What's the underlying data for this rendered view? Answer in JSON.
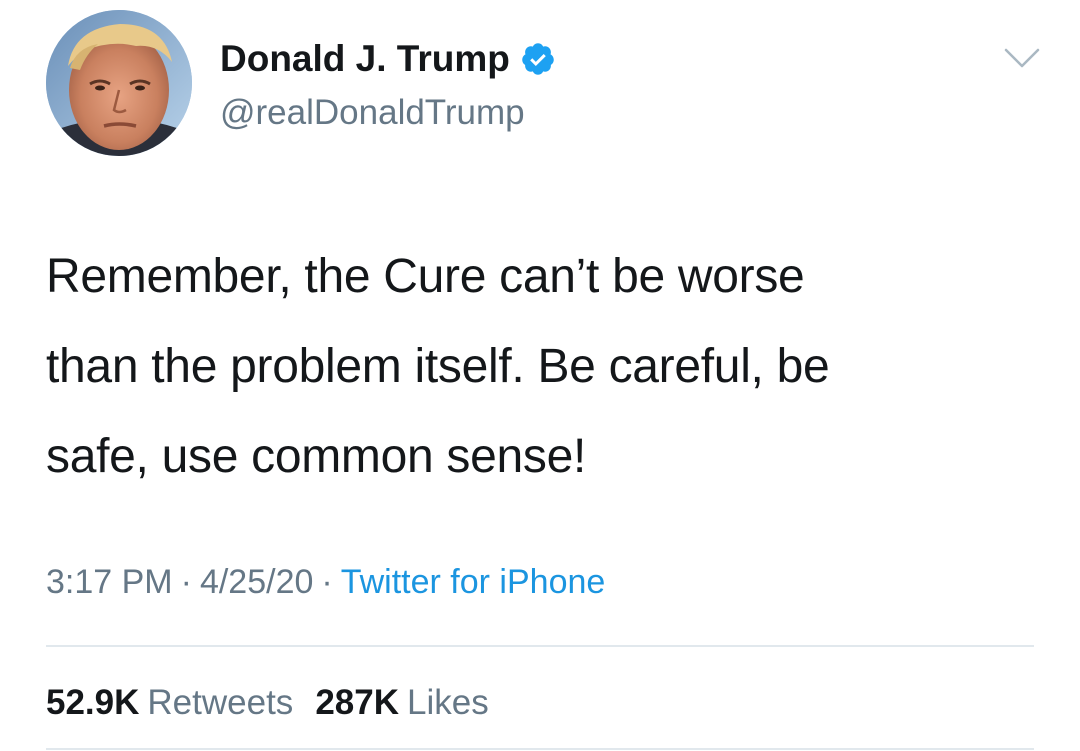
{
  "author": {
    "display_name": "Donald J. Trump",
    "handle": "@realDonaldTrump",
    "verified": true,
    "avatar_icon": "profile-photo"
  },
  "tweet": {
    "text": "Remember, the Cure can’t be worse\nthan the problem itself. Be careful, be\nsafe, use common sense!",
    "time": "3:17 PM",
    "date": "4/25/20",
    "separator": "·",
    "source": "Twitter for iPhone"
  },
  "stats": {
    "retweets_count": "52.9K",
    "retweets_label": "Retweets",
    "likes_count": "287K",
    "likes_label": "Likes"
  },
  "colors": {
    "text_primary": "#14171a",
    "text_secondary": "#657786",
    "link_blue": "#1b95e0",
    "verified_blue": "#1da1f2",
    "divider": "#e1e8ed"
  },
  "icons": {
    "verified": "verified-badge-icon",
    "menu": "chevron-down-icon"
  }
}
